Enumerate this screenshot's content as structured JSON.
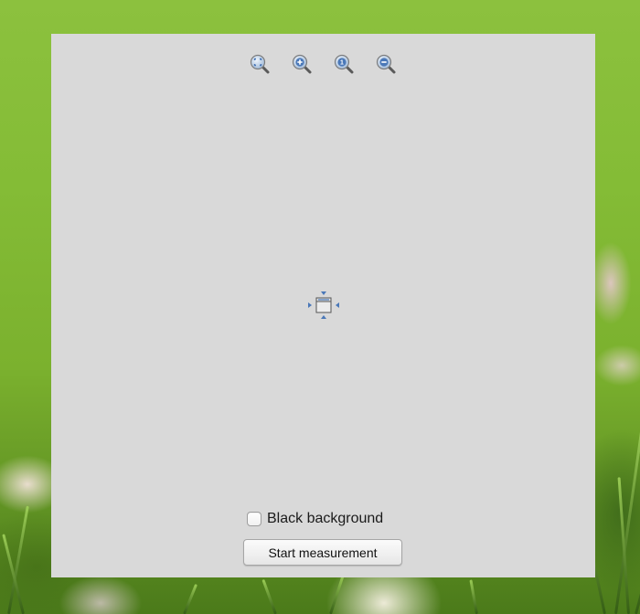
{
  "window": {
    "background_color": "#d9d9d9"
  },
  "toolbar": {
    "buttons": [
      {
        "icon": "zoom-fit-icon"
      },
      {
        "icon": "zoom-in-icon"
      },
      {
        "icon": "zoom-actual-size-icon",
        "glyph": "1"
      },
      {
        "icon": "zoom-out-icon"
      }
    ]
  },
  "canvas": {
    "center_icon": "move-handle-icon"
  },
  "controls": {
    "black_background_label": "Black background",
    "black_background_checked": false,
    "start_button_label": "Start measurement"
  },
  "colors": {
    "icon_blue": "#4a78b8",
    "wallpaper_green": "#84bc36"
  }
}
